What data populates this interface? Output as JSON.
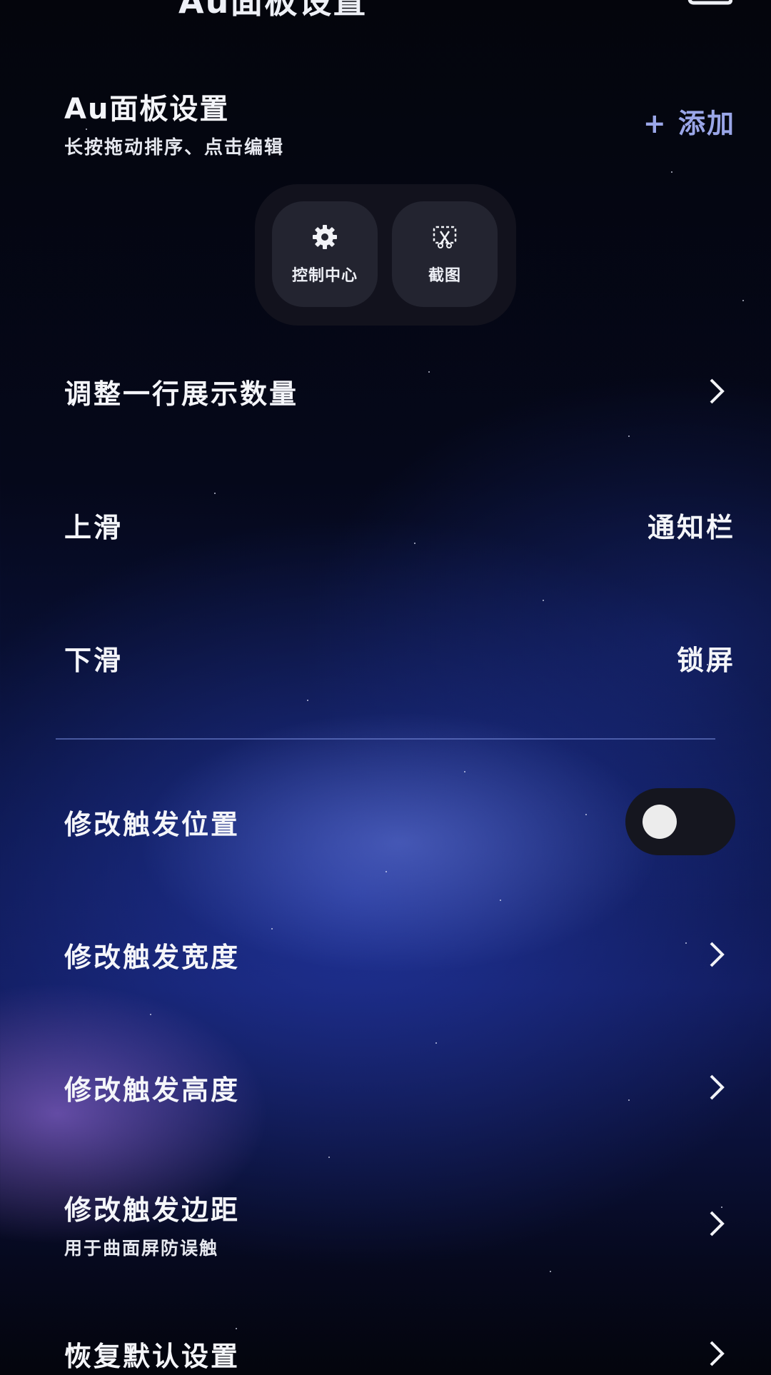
{
  "header": {
    "title": "Au面板设置"
  },
  "section": {
    "title": "Au面板设置",
    "subtitle": "长按拖动排序、点击编辑",
    "add_label": "+ 添加"
  },
  "panel": {
    "tiles": [
      {
        "label": "控制中心",
        "icon": "gear-icon"
      },
      {
        "label": "截图",
        "icon": "screenshot-icon"
      }
    ]
  },
  "settings": {
    "row_count": {
      "label": "调整一行展示数量"
    },
    "swipe_up": {
      "label": "上滑",
      "value": "通知栏"
    },
    "swipe_down": {
      "label": "下滑",
      "value": "锁屏"
    },
    "trigger_position": {
      "label": "修改触发位置",
      "enabled": false
    },
    "trigger_width": {
      "label": "修改触发宽度"
    },
    "trigger_height": {
      "label": "修改触发高度"
    },
    "trigger_margin": {
      "label": "修改触发边距",
      "sublabel": "用于曲面屏防误触"
    },
    "restore_default": {
      "label": "恢复默认设置"
    }
  },
  "colors": {
    "accent": "#9aa6e8",
    "divider": "#7888dc"
  }
}
